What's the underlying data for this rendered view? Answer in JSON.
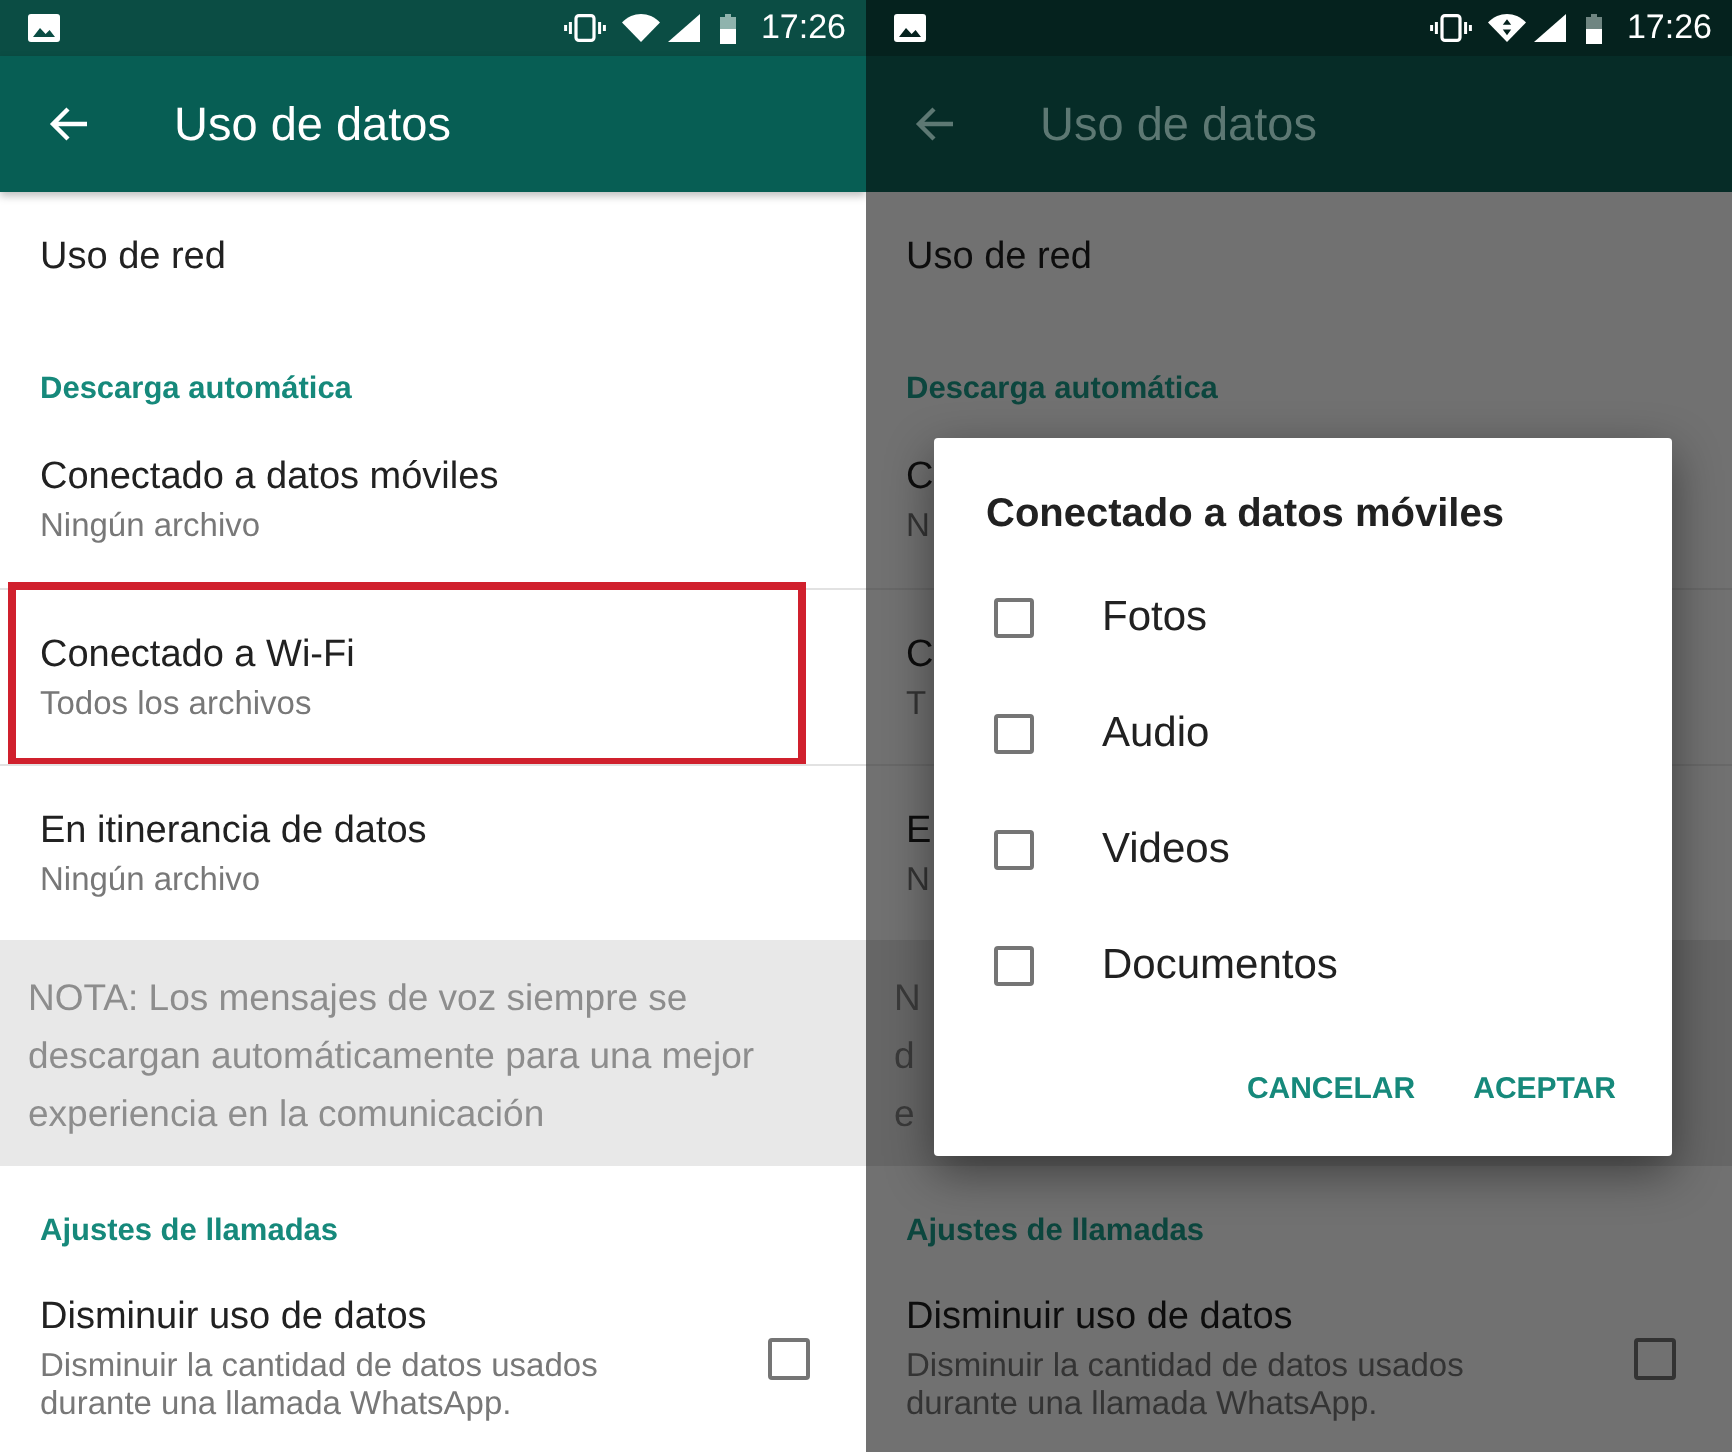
{
  "screens": [
    {
      "dimmed": false,
      "status_bar": {
        "time": "17:26",
        "wifi_transfer": false
      },
      "app_bar": {
        "title": "Uso de datos"
      },
      "items": [
        {
          "kind": "row",
          "title": "Uso de red"
        },
        {
          "kind": "header",
          "title": "Descarga automática"
        },
        {
          "kind": "row",
          "title": "Conectado a datos móviles",
          "subtitle": "Ningún archivo"
        },
        {
          "kind": "row",
          "title": "Conectado a Wi-Fi",
          "subtitle": "Todos los archivos",
          "highlighted": true
        },
        {
          "kind": "row",
          "title": "En itinerancia de datos",
          "subtitle": "Ningún archivo"
        },
        {
          "kind": "note",
          "lines": [
            "NOTA: Los mensajes de voz siempre se",
            "descargan automáticamente para una mejor",
            "experiencia en la comunicación"
          ]
        },
        {
          "kind": "header",
          "title": "Ajustes de llamadas"
        },
        {
          "kind": "checkbox",
          "title": "Disminuir uso de datos",
          "subtitle": "Disminuir la cantidad de datos usados durante una llamada WhatsApp.",
          "checked": false
        }
      ]
    },
    {
      "dimmed": true,
      "status_bar": {
        "time": "17:26",
        "wifi_transfer": true
      },
      "app_bar": {
        "title": "Uso de datos"
      },
      "items": [
        {
          "kind": "row",
          "title": "Uso de red"
        },
        {
          "kind": "header",
          "title": "Descarga automática"
        },
        {
          "kind": "row",
          "title": "C",
          "subtitle": "N"
        },
        {
          "kind": "row",
          "title": "C",
          "subtitle": "T"
        },
        {
          "kind": "row",
          "title": "E",
          "subtitle": "N"
        },
        {
          "kind": "note",
          "lines": [
            "N",
            "d",
            "e"
          ]
        },
        {
          "kind": "header",
          "title": "Ajustes de llamadas"
        },
        {
          "kind": "checkbox",
          "title": "Disminuir uso de datos",
          "subtitle": "Disminuir la cantidad de datos usados durante una llamada WhatsApp.",
          "checked": false
        }
      ],
      "dialog": {
        "title": "Conectado a datos móviles",
        "options": [
          {
            "label": "Fotos",
            "checked": false
          },
          {
            "label": "Audio",
            "checked": false
          },
          {
            "label": "Videos",
            "checked": false
          },
          {
            "label": "Documentos",
            "checked": false
          }
        ],
        "buttons": [
          "CANCELAR",
          "ACEPTAR"
        ]
      }
    }
  ]
}
